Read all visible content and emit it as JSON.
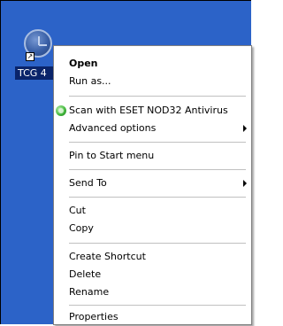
{
  "desktop": {
    "icon_label": "TCG 4"
  },
  "menu": {
    "open": "Open",
    "run_as": "Run as...",
    "scan_eset": "Scan with ESET NOD32 Antivirus",
    "advanced_options": "Advanced options",
    "pin_start": "Pin to Start menu",
    "send_to": "Send To",
    "cut": "Cut",
    "copy": "Copy",
    "create_shortcut": "Create Shortcut",
    "delete": "Delete",
    "rename": "Rename",
    "properties": "Properties"
  },
  "icons": {
    "desktop_icon": "clock-icon",
    "overlay": "shortcut-arrow-icon",
    "eset": "eset-icon",
    "submenu": "chevron-right-icon"
  }
}
